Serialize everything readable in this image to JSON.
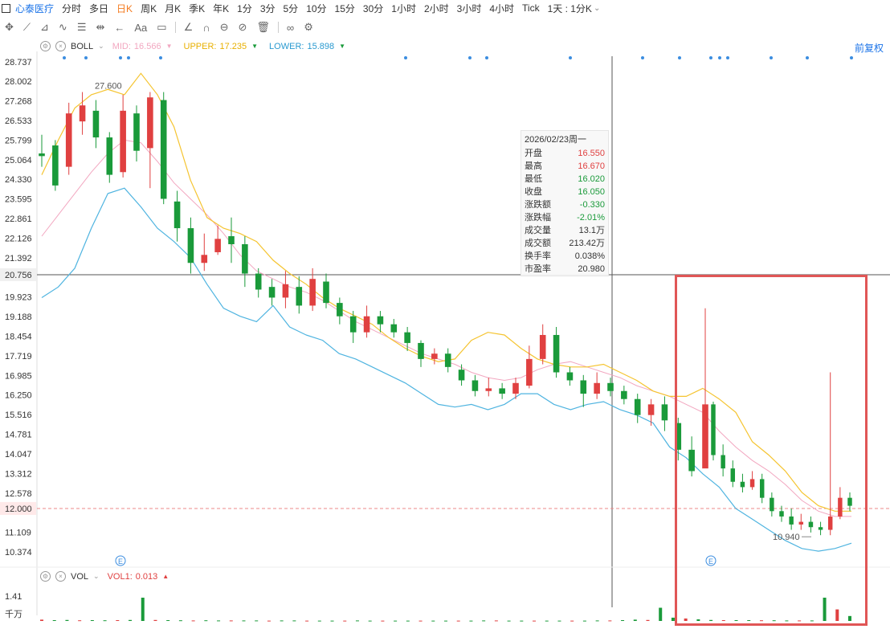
{
  "topbar": {
    "stock_name": "心泰医疗",
    "periods": [
      "分时",
      "多日",
      "日K",
      "周K",
      "月K",
      "季K",
      "年K",
      "1分",
      "3分",
      "5分",
      "10分",
      "15分",
      "30分",
      "1小时",
      "2小时",
      "3小时",
      "4小时",
      "Tick"
    ],
    "active_period": "日K",
    "interval_select": "1天 : 1分K"
  },
  "toolbar": {
    "tools": [
      "move-icon",
      "line-icon",
      "channel-icon",
      "wave-icon",
      "fib-icon",
      "range-icon",
      "arrow-icon",
      "text-icon",
      "note-icon",
      "angle-icon",
      "arc-icon",
      "circle-icon",
      "hide-icon",
      "trash-icon",
      "link-icon",
      "settings-icon"
    ],
    "text_tool_label": "Aa"
  },
  "boll": {
    "name": "BOLL",
    "mid_label": "MID:",
    "mid_value": "16.566",
    "upper_label": "UPPER:",
    "upper_value": "17.235",
    "lower_label": "LOWER:",
    "lower_value": "15.898",
    "colors": {
      "mid": "#f2a7c0",
      "upper": "#f5c430",
      "lower": "#4fb4e0"
    }
  },
  "adjust_label": "前复权",
  "vol": {
    "name": "VOL",
    "vol1_label": "VOL1:",
    "vol1_value": "0.013",
    "axis_top": "1.41",
    "axis_unit": "千万"
  },
  "tooltip": {
    "date": "2026/02/23周一",
    "rows": [
      {
        "k": "开盘",
        "v": "16.550",
        "c": "#e04040"
      },
      {
        "k": "最高",
        "v": "16.670",
        "c": "#e04040"
      },
      {
        "k": "最低",
        "v": "16.020",
        "c": "#1a9a3a"
      },
      {
        "k": "收盘",
        "v": "16.050",
        "c": "#1a9a3a"
      },
      {
        "k": "涨跌额",
        "v": "-0.330",
        "c": "#1a9a3a"
      },
      {
        "k": "涨跌幅",
        "v": "-2.01%",
        "c": "#1a9a3a"
      },
      {
        "k": "成交量",
        "v": "13.1万",
        "c": "#333"
      },
      {
        "k": "成交额",
        "v": "213.42万",
        "c": "#333"
      },
      {
        "k": "换手率",
        "v": "0.038%",
        "c": "#333"
      },
      {
        "k": "市盈率",
        "v": "20.980",
        "c": "#333"
      }
    ]
  },
  "chart_data": {
    "type": "candlestick",
    "y_ticks": [
      "28.737",
      "28.002",
      "27.268",
      "26.533",
      "25.799",
      "25.064",
      "24.330",
      "23.595",
      "22.861",
      "22.126",
      "21.392",
      "20.756",
      "19.923",
      "19.188",
      "18.454",
      "17.719",
      "16.985",
      "16.250",
      "15.516",
      "14.781",
      "14.047",
      "13.312",
      "12.578",
      "12.000",
      "11.109",
      "10.374"
    ],
    "crosshair_price": "20.756",
    "ref_price": "12.000",
    "ylim": [
      10.0,
      29.2
    ],
    "annotations": [
      {
        "text": "27.600",
        "price": 27.6
      },
      {
        "text": "10.940",
        "price": 10.94
      }
    ],
    "event_markers": [
      "E",
      "E"
    ],
    "up_color": "#e04040",
    "down_color": "#1a9a3a",
    "mid_series": [
      22.2,
      23.0,
      23.8,
      24.6,
      25.3,
      25.8,
      25.7,
      25.0,
      24.2,
      23.6,
      23.0,
      22.3,
      21.5,
      20.9,
      20.6,
      20.3,
      20.1,
      19.8,
      19.4,
      19.0,
      18.7,
      18.4,
      18.1,
      17.8,
      17.6,
      17.4,
      17.1,
      16.9,
      16.8,
      16.9,
      17.2,
      17.4,
      17.5,
      17.3,
      17.1,
      16.9,
      16.6,
      16.4,
      16.2,
      15.9,
      15.6,
      14.9,
      14.3,
      13.8,
      13.4,
      12.9,
      12.3,
      11.9,
      11.7,
      11.7
    ],
    "upper_series": [
      24.5,
      25.8,
      27.0,
      27.5,
      27.7,
      27.5,
      28.3,
      27.5,
      26.3,
      24.3,
      22.9,
      22.5,
      22.3,
      22.0,
      21.3,
      20.8,
      20.4,
      19.9,
      19.5,
      19.2,
      18.9,
      18.4,
      18.0,
      17.7,
      17.5,
      17.6,
      18.3,
      18.6,
      18.5,
      18.0,
      17.6,
      17.4,
      17.3,
      17.3,
      17.4,
      17.1,
      16.8,
      16.4,
      16.2,
      16.2,
      16.5,
      16.1,
      15.6,
      14.5,
      14.0,
      13.4,
      12.6,
      12.1,
      11.9,
      11.9
    ],
    "lower_series": [
      19.9,
      20.3,
      21.0,
      22.5,
      23.8,
      24.0,
      23.3,
      22.5,
      22.0,
      21.4,
      20.4,
      19.5,
      19.2,
      19.0,
      19.6,
      18.8,
      18.5,
      18.3,
      17.8,
      17.6,
      17.3,
      17.0,
      16.7,
      16.3,
      15.9,
      15.8,
      15.9,
      15.7,
      15.9,
      16.3,
      16.3,
      15.9,
      15.7,
      15.9,
      16.0,
      15.7,
      15.5,
      15.2,
      14.3,
      13.9,
      13.3,
      12.8,
      12.0,
      11.6,
      11.2,
      10.8,
      10.5,
      10.4,
      10.5,
      10.7
    ],
    "candles": [
      [
        25.3,
        25.2,
        26.0,
        24.8
      ],
      [
        25.6,
        24.1,
        25.8,
        23.9
      ],
      [
        24.8,
        26.8,
        27.2,
        24.5
      ],
      [
        26.5,
        27.1,
        27.6,
        26.0
      ],
      [
        26.9,
        25.9,
        27.3,
        25.5
      ],
      [
        25.9,
        24.5,
        26.1,
        24.2
      ],
      [
        24.6,
        26.9,
        27.5,
        24.4
      ],
      [
        26.8,
        25.4,
        27.1,
        25.0
      ],
      [
        25.5,
        27.4,
        27.6,
        24.0
      ],
      [
        27.3,
        23.6,
        27.6,
        23.4
      ],
      [
        23.5,
        22.5,
        23.9,
        22.0
      ],
      [
        22.5,
        21.2,
        22.9,
        20.8
      ],
      [
        21.2,
        21.5,
        22.3,
        20.9
      ],
      [
        21.6,
        22.1,
        22.6,
        21.5
      ],
      [
        22.2,
        21.9,
        22.9,
        21.2
      ],
      [
        21.9,
        20.8,
        22.2,
        20.3
      ],
      [
        20.8,
        20.2,
        21.0,
        19.9
      ],
      [
        20.3,
        19.9,
        20.6,
        19.6
      ],
      [
        19.9,
        20.4,
        20.9,
        19.5
      ],
      [
        20.3,
        19.6,
        20.7,
        19.3
      ],
      [
        19.6,
        20.6,
        21.0,
        19.4
      ],
      [
        20.5,
        19.7,
        20.8,
        19.5
      ],
      [
        19.7,
        19.2,
        19.9,
        18.9
      ],
      [
        19.2,
        18.6,
        19.4,
        18.2
      ],
      [
        18.6,
        19.2,
        19.6,
        18.4
      ],
      [
        19.2,
        18.9,
        19.4,
        18.6
      ],
      [
        18.9,
        18.6,
        19.1,
        18.4
      ],
      [
        18.6,
        18.2,
        18.8,
        17.9
      ],
      [
        18.2,
        17.6,
        18.3,
        17.3
      ],
      [
        17.6,
        17.8,
        18.0,
        17.4
      ],
      [
        17.8,
        17.3,
        18.0,
        17.1
      ],
      [
        17.2,
        16.8,
        17.4,
        16.6
      ],
      [
        16.8,
        16.4,
        17.0,
        16.2
      ],
      [
        16.4,
        16.5,
        16.9,
        16.2
      ],
      [
        16.5,
        16.3,
        16.7,
        16.1
      ],
      [
        16.3,
        16.7,
        16.9,
        16.1
      ],
      [
        16.6,
        17.6,
        18.1,
        16.5
      ],
      [
        17.6,
        18.5,
        18.9,
        17.4
      ],
      [
        18.5,
        17.1,
        18.8,
        16.9
      ],
      [
        17.1,
        16.8,
        17.3,
        16.6
      ],
      [
        16.8,
        16.3,
        17.0,
        15.8
      ],
      [
        16.3,
        16.7,
        17.1,
        16.1
      ],
      [
        16.7,
        16.4,
        16.9,
        16.2
      ],
      [
        16.4,
        16.1,
        16.6,
        15.9
      ],
      [
        16.1,
        15.5,
        16.3,
        15.2
      ],
      [
        15.5,
        15.9,
        16.1,
        15.1
      ],
      [
        15.9,
        15.3,
        16.2,
        14.9
      ],
      [
        15.2,
        14.2,
        15.4,
        13.8
      ],
      [
        14.2,
        13.4,
        14.7,
        13.2
      ],
      [
        13.5,
        15.9,
        19.5,
        13.6
      ]
    ],
    "candles2": [
      [
        15.9,
        14.0,
        16.0,
        13.8
      ],
      [
        14.0,
        13.5,
        14.4,
        13.2
      ],
      [
        13.5,
        13.0,
        13.8,
        12.8
      ],
      [
        13.0,
        12.8,
        13.3,
        12.6
      ],
      [
        12.8,
        13.1,
        13.4,
        12.7
      ],
      [
        13.1,
        12.4,
        13.3,
        12.2
      ],
      [
        12.4,
        11.9,
        12.6,
        11.7
      ],
      [
        11.9,
        11.7,
        12.1,
        11.5
      ],
      [
        11.7,
        11.4,
        12.0,
        11.2
      ],
      [
        11.4,
        11.5,
        11.8,
        11.2
      ],
      [
        11.5,
        11.3,
        11.7,
        11.1
      ],
      [
        11.3,
        11.2,
        11.5,
        11.0
      ],
      [
        11.2,
        11.7,
        17.1,
        11.0
      ],
      [
        11.7,
        12.4,
        12.8,
        11.6
      ],
      [
        12.4,
        12.1,
        12.6,
        11.9
      ]
    ],
    "volumes": [
      0.08,
      0.05,
      0.06,
      0.04,
      0.05,
      0.04,
      0.05,
      0.06,
      1.41,
      0.06,
      0.05,
      0.04,
      0.03,
      0.04,
      0.03,
      0.03,
      0.03,
      0.03,
      0.02,
      0.03,
      0.03,
      0.02,
      0.02,
      0.02,
      0.02,
      0.03,
      0.02,
      0.02,
      0.02,
      0.02,
      0.02,
      0.02,
      0.02,
      0.02,
      0.02,
      0.03,
      0.03,
      0.02,
      0.02,
      0.02,
      0.02,
      0.02,
      0.02,
      0.02,
      0.03,
      0.03,
      0.05,
      0.08,
      0.06,
      0.8,
      0.2,
      0.15,
      0.1,
      0.06,
      0.05,
      0.05,
      0.05,
      0.04,
      0.04,
      0.03,
      0.03,
      0.03,
      1.41,
      0.7,
      0.3
    ]
  }
}
